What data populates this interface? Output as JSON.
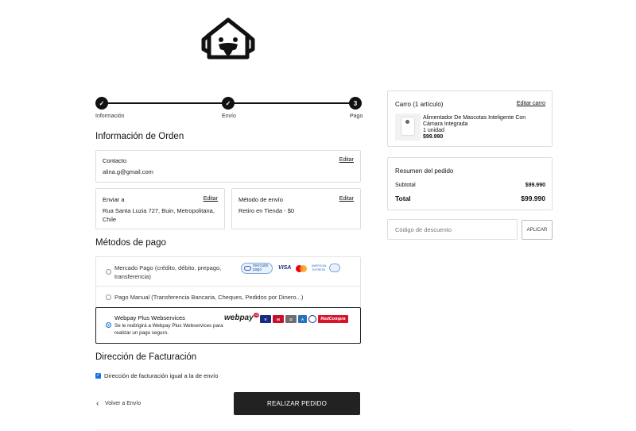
{
  "steps": [
    {
      "label": "Información",
      "state": "done"
    },
    {
      "label": "Envío",
      "state": "done"
    },
    {
      "label": "Pago",
      "state": "current",
      "number": "3"
    }
  ],
  "order": {
    "title": "Información de Orden",
    "contact": {
      "label": "Contacto",
      "edit": "Editar",
      "value": "alina.g@gmail.com"
    },
    "ship_to": {
      "label": "Enviar a",
      "edit": "Editar",
      "value": "Rua Santa Luzia 727, Buin, Metropolitana, Chile"
    },
    "ship_method": {
      "label": "Método de envío",
      "edit": "Editar",
      "value": "Retiro en Tienda - $0"
    }
  },
  "payment": {
    "title": "Métodos de pago",
    "options": [
      {
        "label": "Mercado Pago (crédito, débito, prepago, transferencia)",
        "selected": false
      },
      {
        "label": "Pago Manual (Transferencia Bancaria, Cheques, Pedidos por Dinero...)",
        "selected": false
      },
      {
        "label": "Webpay Plus Webservices",
        "sub": "Se le redirigirá a Webpay Plus Webservices para realizar un pago seguro.",
        "selected": true
      }
    ],
    "mp_logo": {
      "line1": "mercado",
      "line2": "pago"
    },
    "visa": "VISA",
    "amex": "AMERICAN EXPRESS",
    "webpay": {
      "text": "webpay",
      "suffix": ".cl",
      "redcompra": "RedCompra"
    }
  },
  "billing": {
    "title": "Dirección de Facturación",
    "same_label": "Dirección de facturación igual a la de envío",
    "checked": true
  },
  "actions": {
    "back": "Volver a Envío",
    "submit": "REALIZAR PEDIDO"
  },
  "cart": {
    "title": "Carro (1 artículo)",
    "edit": "Editar carro",
    "item": {
      "name": "Alimentador De Mascotas Inteligente Con Cámara Integrada",
      "qty": "1 unidad",
      "price": "$99.990"
    }
  },
  "summary": {
    "title": "Resumen del pedido",
    "subtotal_label": "Subtotal",
    "subtotal": "$99.990",
    "total_label": "Total",
    "total": "$99.990"
  },
  "discount": {
    "placeholder": "Código de descuento",
    "apply": "APLICAR"
  },
  "colors": {
    "accent": "#1a6fe0",
    "dark": "#222222"
  }
}
